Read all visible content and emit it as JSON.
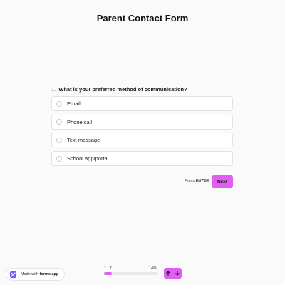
{
  "form": {
    "title": "Parent Contact Form"
  },
  "question": {
    "number": "1.",
    "text": "What is your preferred method of communication?",
    "options": [
      "Email",
      "Phone call",
      "Text message",
      "School app/portal"
    ]
  },
  "actions": {
    "press_prefix": "Press",
    "press_key": "ENTER",
    "next_label": "Next"
  },
  "footer": {
    "made_with_prefix": "Made with",
    "made_with_brand": "forms.app",
    "progress_count": "1 / 7",
    "progress_percent_label": "14%",
    "progress_fraction": 0.14
  },
  "colors": {
    "accent": "#e05ef0",
    "question_number": "#d64fe0"
  },
  "icons": {
    "logo": "forms-app-logo-icon",
    "up": "arrow-up-icon",
    "down": "arrow-down-icon"
  }
}
